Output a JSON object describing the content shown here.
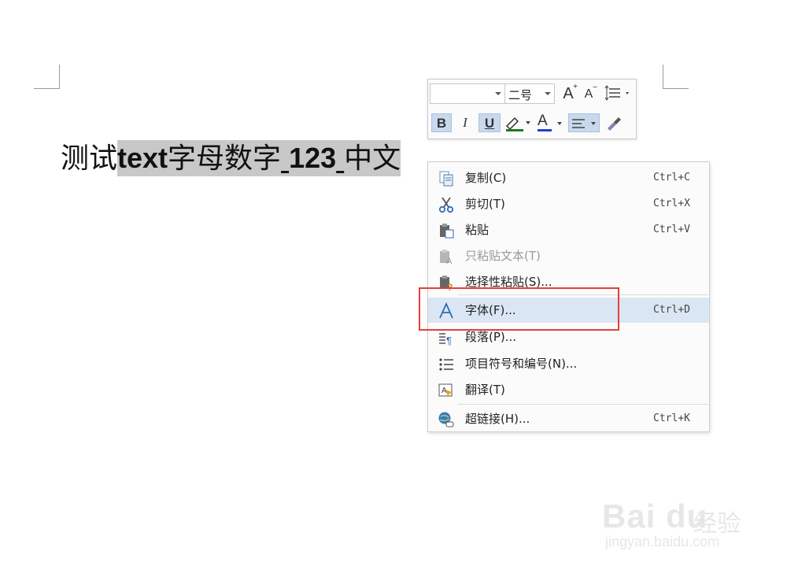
{
  "document": {
    "text_plain": "测试",
    "text_bold": "text",
    "text_mid": "字母数字",
    "text_num": "123",
    "text_end": "中文"
  },
  "mini_toolbar": {
    "font_name": "",
    "font_size": "二号",
    "grow_font": "A",
    "shrink_font": "A",
    "bold": "B",
    "italic": "I",
    "underline": "U",
    "font_color": "A",
    "colors": {
      "font_color": "#1f3fd6",
      "highlight": "#1f7a1f",
      "active_bg": "#c8d9ee"
    }
  },
  "context_menu": {
    "items": [
      {
        "icon": "copy-icon",
        "label": "复制(C)",
        "shortcut": "Ctrl+C",
        "enabled": true
      },
      {
        "icon": "scissors-icon",
        "label": "剪切(T)",
        "shortcut": "Ctrl+X",
        "enabled": true
      },
      {
        "icon": "paste-icon",
        "label": "粘贴",
        "shortcut": "Ctrl+V",
        "enabled": true
      },
      {
        "icon": "paste-text-only-icon",
        "label": "只粘贴文本(T)",
        "shortcut": "",
        "enabled": false
      },
      {
        "icon": "paste-special-icon",
        "label": "选择性粘贴(S)...",
        "shortcut": "",
        "enabled": true
      },
      {
        "icon": "font-icon",
        "label": "字体(F)...",
        "shortcut": "Ctrl+D",
        "enabled": true,
        "highlighted": true
      },
      {
        "icon": "paragraph-icon",
        "label": "段落(P)...",
        "shortcut": "",
        "enabled": true
      },
      {
        "icon": "bullets-numbering-icon",
        "label": "项目符号和编号(N)...",
        "shortcut": "",
        "enabled": true
      },
      {
        "icon": "translate-icon",
        "label": "翻译(T)",
        "shortcut": "",
        "enabled": true
      },
      {
        "icon": "hyperlink-icon",
        "label": "超链接(H)...",
        "shortcut": "Ctrl+K",
        "enabled": true
      }
    ],
    "highlight_color": "#dbe6f4",
    "annotation_color": "#e3403a"
  },
  "watermark": {
    "logo_text": "Bai du",
    "cn_text": "经验",
    "url": "jingyan.baidu.com"
  }
}
